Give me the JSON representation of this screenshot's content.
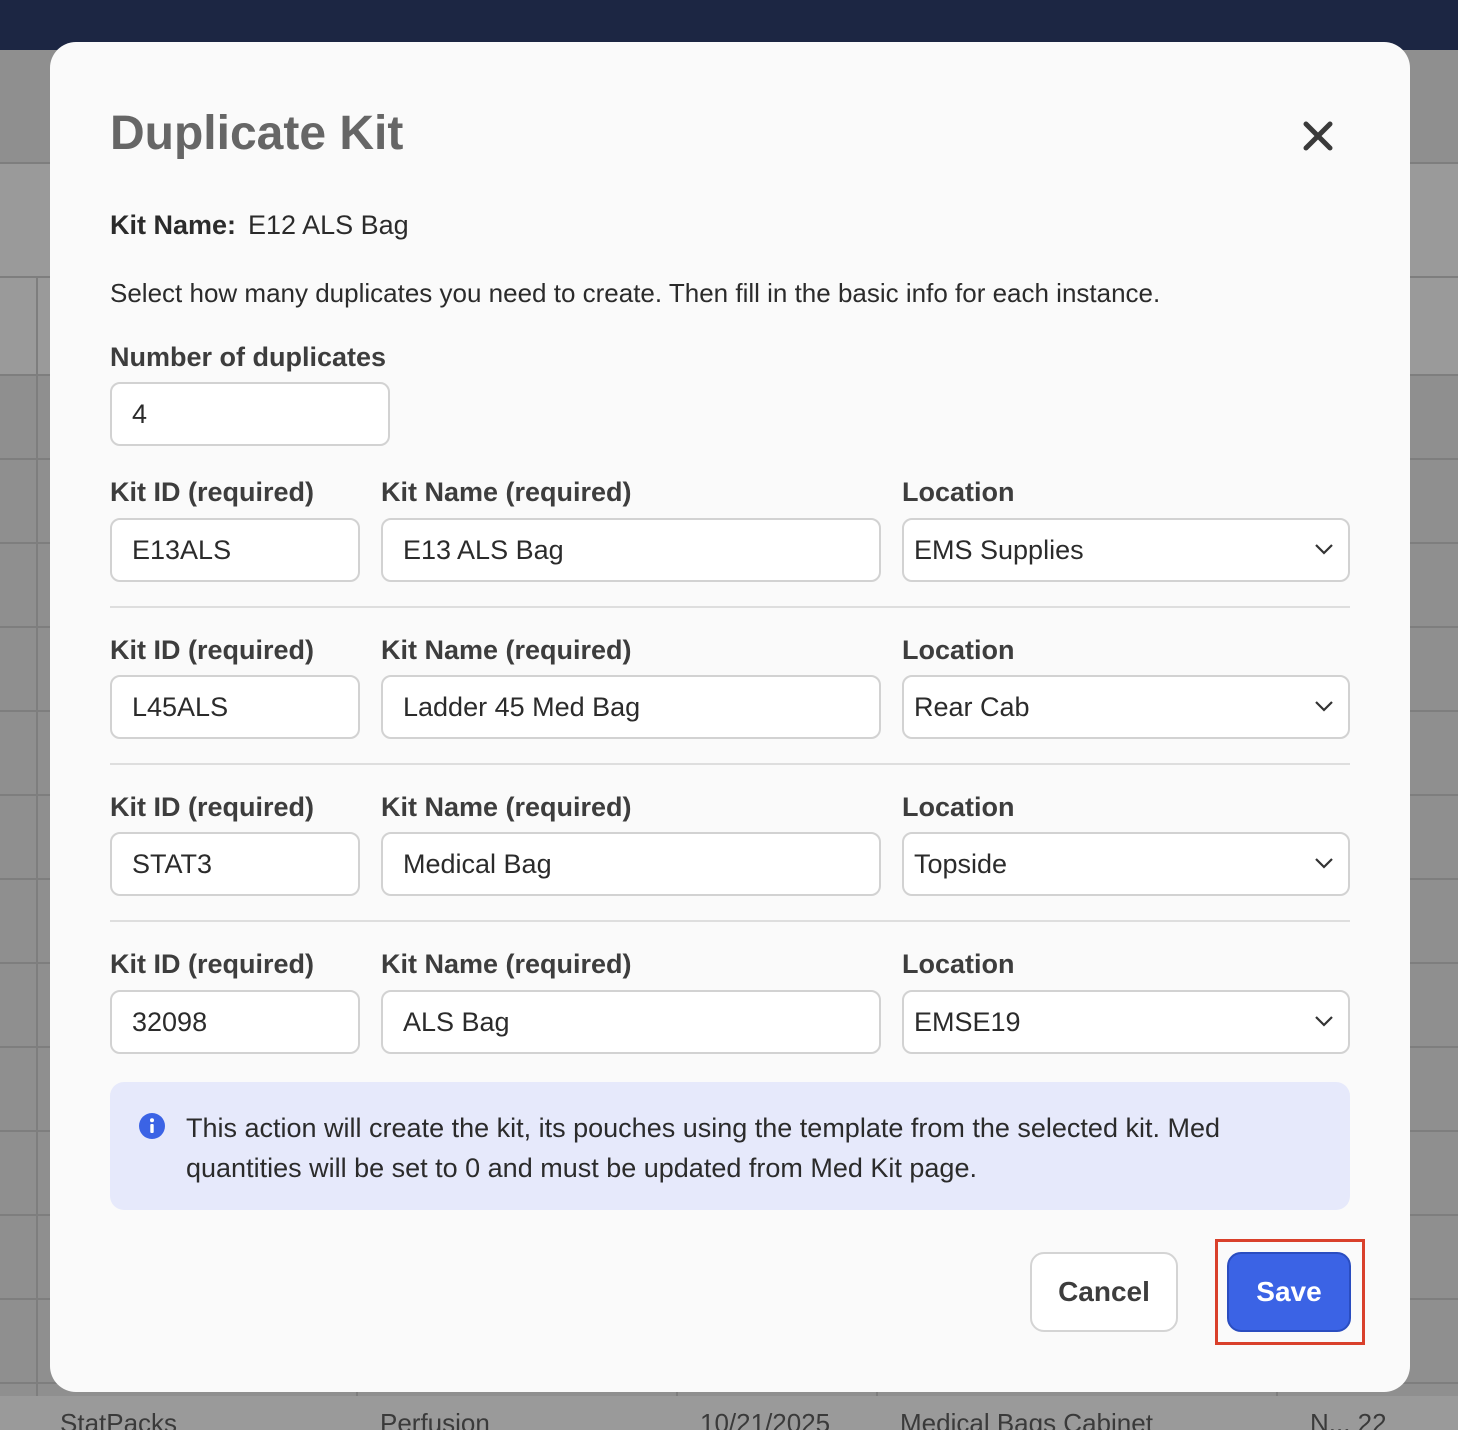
{
  "modal": {
    "title": "Duplicate Kit",
    "kit_name_label": "Kit Name:",
    "kit_name_value": "E12 ALS Bag",
    "instructions": "Select how many duplicates you need to create. Then fill in the basic info for each instance.",
    "duplicates_label": "Number of duplicates",
    "duplicates_value": "4",
    "labels": {
      "kit_id": "Kit ID (required)",
      "kit_name": "Kit Name (required)",
      "location": "Location"
    },
    "rows": [
      {
        "kit_id": "E13ALS",
        "kit_name": "E13 ALS Bag",
        "location": "EMS Supplies"
      },
      {
        "kit_id": "L45ALS",
        "kit_name": "Ladder 45 Med Bag",
        "location": "Rear Cab"
      },
      {
        "kit_id": "STAT3",
        "kit_name": "Medical Bag",
        "location": "Topside"
      },
      {
        "kit_id": "32098",
        "kit_name": "ALS Bag",
        "location": "EMSE19"
      }
    ],
    "info_text": "This action will create the kit, its pouches using the template from the selected kit. Med quantities will be set to 0 and must be updated from Med Kit page.",
    "cancel_label": "Cancel",
    "save_label": "Save"
  },
  "background": {
    "bottom_row": [
      "StatPacks",
      "Perfusion",
      "10/21/2025",
      "Medical Bags Cabinet",
      "N... 22"
    ]
  },
  "icons": {
    "close": "close-icon",
    "chevron": "chevron-down-icon",
    "info": "info-icon"
  },
  "colors": {
    "primary": "#3b63e5",
    "info_bg": "#e6e9fb",
    "highlight": "#d9402b",
    "topbar": "#1c2643"
  }
}
